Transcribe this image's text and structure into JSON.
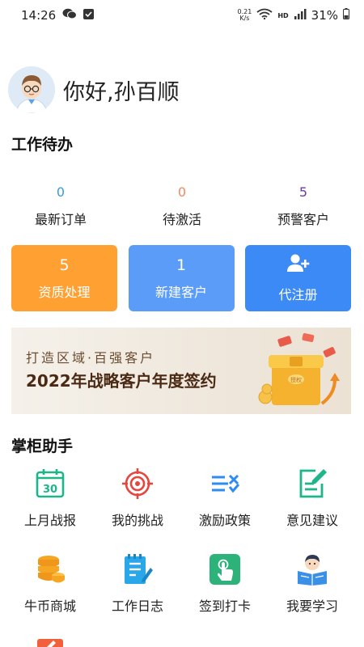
{
  "status": {
    "time": "14:26",
    "speed_top": "0.21",
    "speed_bottom": "K/s",
    "hd": "HD",
    "battery": "31%"
  },
  "greeting": "你好,孙百顺",
  "todo": {
    "title": "工作待办",
    "stats": [
      {
        "value": "0",
        "label": "最新订单",
        "color": "#3a9bdc"
      },
      {
        "value": "0",
        "label": "待激活",
        "color": "#f08a5d"
      },
      {
        "value": "5",
        "label": "预警客户",
        "color": "#6a3aa8"
      }
    ],
    "tiles": [
      {
        "value": "5",
        "label": "资质处理",
        "color": "#ffa033"
      },
      {
        "value": "1",
        "label": "新建客户",
        "color": "#5a9cf8"
      },
      {
        "value": "",
        "label": "代注册",
        "color": "#3c8af5",
        "icon": "add-user-icon"
      }
    ]
  },
  "banner": {
    "line1": "打造区域·百强客户",
    "line2": "2022年战略客户年度签约",
    "box_label": "授权"
  },
  "helper": {
    "title": "掌柜助手",
    "items": [
      {
        "label": "上月战报",
        "icon": "calendar-30-icon"
      },
      {
        "label": "我的挑战",
        "icon": "target-icon"
      },
      {
        "label": "激励政策",
        "icon": "policy-list-icon"
      },
      {
        "label": "意见建议",
        "icon": "edit-note-icon"
      },
      {
        "label": "牛币商城",
        "icon": "coin-stack-icon"
      },
      {
        "label": "工作日志",
        "icon": "notebook-pen-icon"
      },
      {
        "label": "签到打卡",
        "icon": "tap-hand-icon"
      },
      {
        "label": "我要学习",
        "icon": "reading-person-icon"
      }
    ],
    "calendar_day": "30"
  }
}
